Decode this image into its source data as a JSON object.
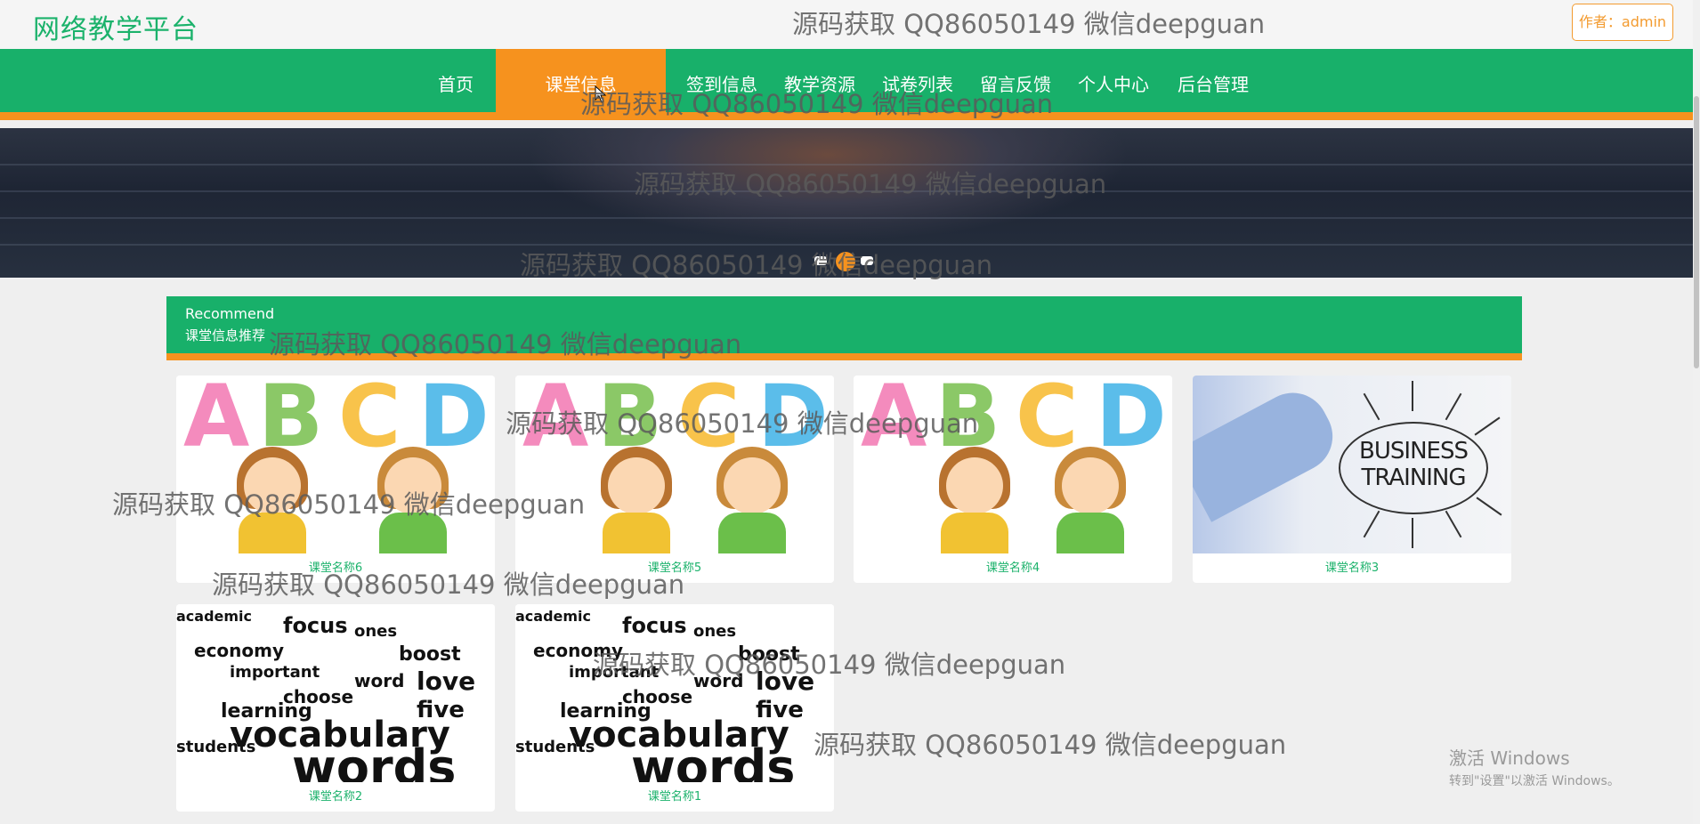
{
  "header": {
    "brand": "网络教学平台",
    "author_button": "作者：admin"
  },
  "nav": {
    "items": [
      {
        "label": "首页"
      },
      {
        "label": "课堂信息",
        "active": true
      },
      {
        "label": "签到信息"
      },
      {
        "label": "教学资源"
      },
      {
        "label": "试卷列表"
      },
      {
        "label": "留言反馈"
      },
      {
        "label": "个人中心"
      },
      {
        "label": "后台管理"
      }
    ]
  },
  "banner": {
    "carousel_pages": 3,
    "active_page": 2
  },
  "section": {
    "title_en": "Recommend",
    "title_cn": "课堂信息推荐"
  },
  "cards": [
    {
      "name": "课堂名称6",
      "image": "abc-kids-illustration"
    },
    {
      "name": "课堂名称5",
      "image": "abc-kids-illustration"
    },
    {
      "name": "课堂名称4",
      "image": "abc-kids-illustration"
    },
    {
      "name": "课堂名称3",
      "image": "business-training-illustration"
    },
    {
      "name": "课堂名称2",
      "image": "vocabulary-word-cloud"
    },
    {
      "name": "课堂名称1",
      "image": "vocabulary-word-cloud"
    }
  ],
  "image_text": {
    "letters": [
      "A",
      "B",
      "C",
      "D"
    ],
    "business": "BUSINESS\nTRAINING",
    "words": [
      "vocabulary",
      "words",
      "learning",
      "economy",
      "focus",
      "love",
      "word",
      "choose",
      "important",
      "academic",
      "students",
      "learn",
      "five",
      "ones",
      "boost"
    ]
  },
  "watermark": "源码获取 QQ86050149 微信deepguan",
  "windows_notice": {
    "title": "激活 Windows",
    "subtitle": "转到\"设置\"以激活 Windows。"
  },
  "colors": {
    "green": "#18b06a",
    "orange": "#f6921e"
  }
}
